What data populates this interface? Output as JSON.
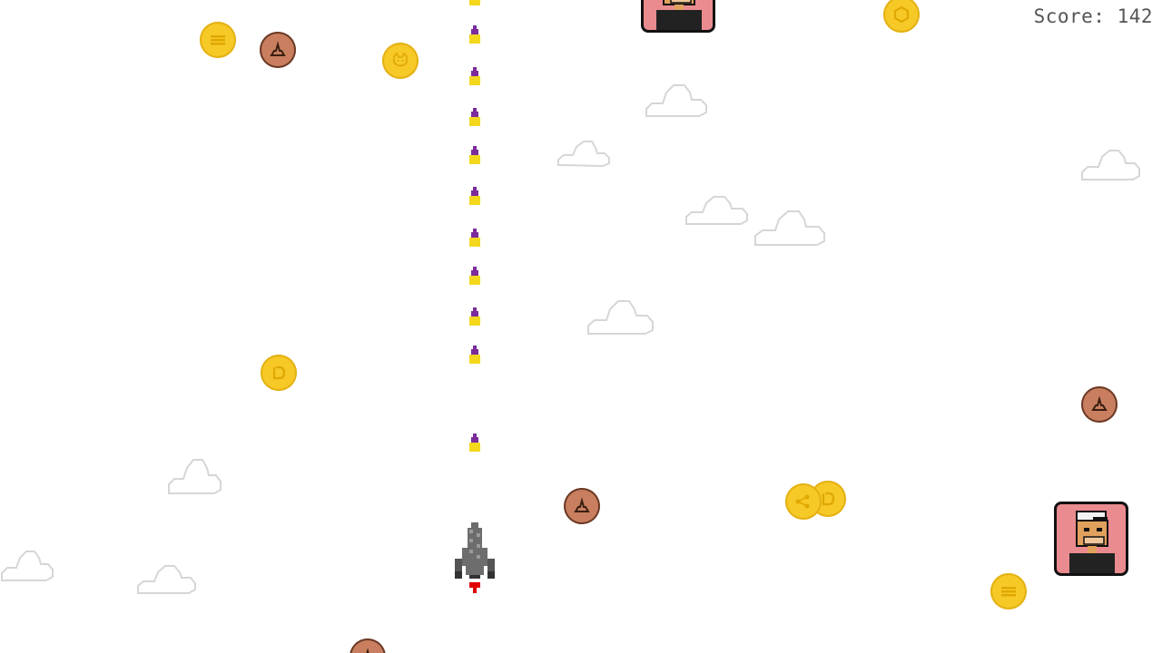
{
  "hud": {
    "score_label": "Score: 142",
    "score": 142
  },
  "colors": {
    "background": "#ffffff",
    "gold_coin": "#f6c927",
    "bronze_coin": "#c97f5f",
    "ape_bg": "#ea8b8f",
    "bullet_tip": "#7b2c9a",
    "bullet_body": "#f4d81e",
    "ship_body": "#6d6d6d",
    "flame": "#e00000"
  },
  "sprites": {
    "player": "rocket-ship",
    "bullet": "laser-bullet",
    "gold_coins": [
      "solana-coin",
      "shiba-coin",
      "dogecoin",
      "chainlink-coin",
      "ripple-coin"
    ],
    "bronze_coins": [
      "poop-coin"
    ],
    "enemies": [
      "bored-ape-nft"
    ],
    "background": [
      "cloud"
    ]
  }
}
